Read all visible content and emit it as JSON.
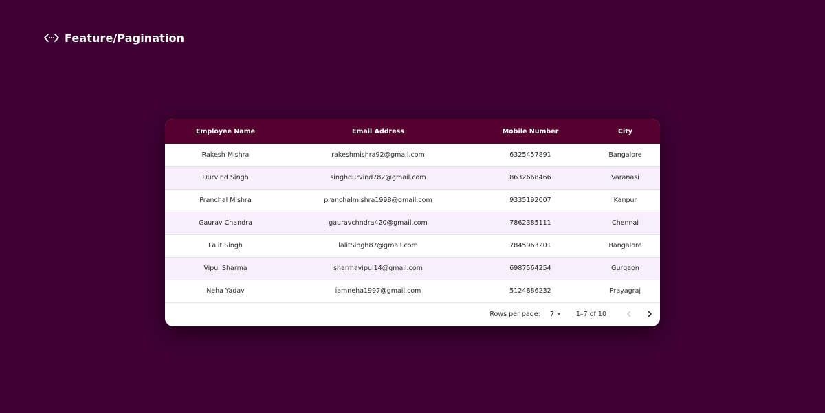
{
  "header": {
    "icon": "code-brackets-icon",
    "title": "Feature/Pagination"
  },
  "colors": {
    "background": "#3e0033",
    "table_header": "#56002f",
    "row_alt": "#f7f0fc"
  },
  "table": {
    "columns": [
      "Employee Name",
      "Email Address",
      "Mobile Number",
      "City"
    ],
    "rows": [
      [
        "Rakesh Mishra",
        "rakeshmishra92@gmail.com",
        "6325457891",
        "Bangalore"
      ],
      [
        "Durvind Singh",
        "singhdurvind782@gmail.com",
        "8632668466",
        "Varanasi"
      ],
      [
        "Pranchal Mishra",
        "pranchalmishra1998@gmail.com",
        "9335192007",
        "Kanpur"
      ],
      [
        "Gaurav Chandra",
        "gauravchndra420@gmail.com",
        "7862385111",
        "Chennai"
      ],
      [
        "Lalit Singh",
        "lalitSingh87@gmail.com",
        "7845963201",
        "Bangalore"
      ],
      [
        "Vipul Sharma",
        "sharmavipul14@gmail.com",
        "6987564254",
        "Gurgaon"
      ],
      [
        "Neha Yadav",
        "iamneha1997@gmail.com",
        "5124886232",
        "Prayagraj"
      ]
    ]
  },
  "pagination": {
    "rows_per_page_label": "Rows per page:",
    "rows_per_page_value": "7",
    "range_text": "1–7 of 10",
    "prev_icon": "chevron-left-icon",
    "next_icon": "chevron-right-icon"
  }
}
